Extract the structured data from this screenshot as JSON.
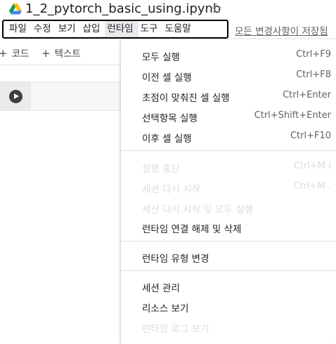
{
  "header": {
    "title": "1_2_pytorch_basic_using.ipynb"
  },
  "menubar": {
    "items": [
      "파일",
      "수정",
      "보기",
      "삽입",
      "런타임",
      "도구",
      "도움말"
    ],
    "save_status": "모든 변경사항이 저장됨"
  },
  "toolbar": {
    "add_code": "코드",
    "add_text": "텍스트"
  },
  "runtime_menu": {
    "groups": [
      [
        {
          "label": "모두 실행",
          "shortcut": "Ctrl+F9",
          "enabled": true
        },
        {
          "label": "이전 셀 실행",
          "shortcut": "Ctrl+F8",
          "enabled": true
        },
        {
          "label": "초점이 맞춰진 셀 실행",
          "shortcut": "Ctrl+Enter",
          "enabled": true
        },
        {
          "label": "선택항목 실행",
          "shortcut": "Ctrl+Shift+Enter",
          "enabled": true
        },
        {
          "label": "이후 셀 실행",
          "shortcut": "Ctrl+F10",
          "enabled": true
        }
      ],
      [
        {
          "label": "실행 중단",
          "shortcut": "Ctrl+M I",
          "enabled": false
        },
        {
          "label": "세션 다시 시작",
          "shortcut": "Ctrl+M .",
          "enabled": false
        },
        {
          "label": "세션 다시 시작 및 모두 실행",
          "shortcut": "",
          "enabled": false
        },
        {
          "label": "런타임 연결 해제 및 삭제",
          "shortcut": "",
          "enabled": true
        }
      ],
      [
        {
          "label": "런타임 유형 변경",
          "shortcut": "",
          "enabled": true
        }
      ],
      [
        {
          "label": "세션 관리",
          "shortcut": "",
          "enabled": true
        },
        {
          "label": "리소스 보기",
          "shortcut": "",
          "enabled": true
        },
        {
          "label": "런타임 로그 보기",
          "shortcut": "",
          "enabled": false
        }
      ]
    ]
  }
}
